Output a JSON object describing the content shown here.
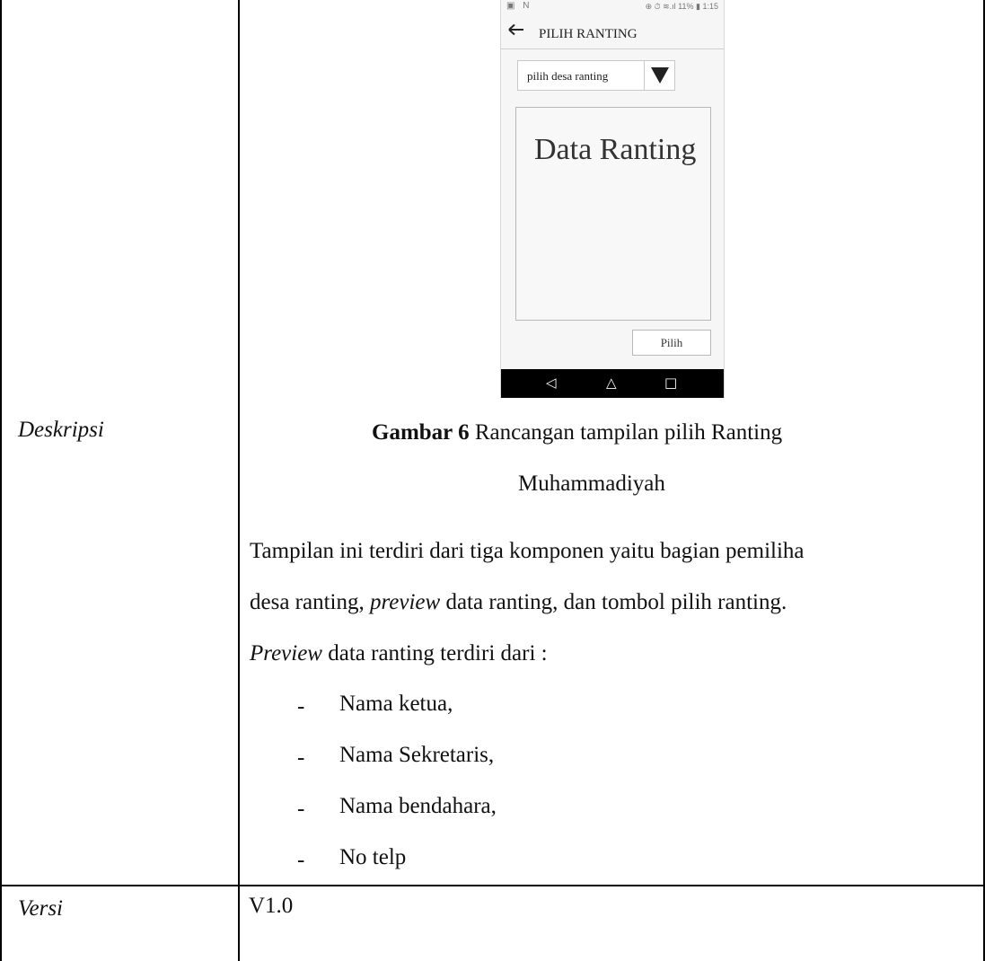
{
  "table": {
    "rows": [
      {
        "label": "Deskripsi"
      },
      {
        "label": "Versi",
        "value": "V1.0"
      }
    ]
  },
  "mockup": {
    "status_bar": {
      "left_icons": "▣ N",
      "right_text": "⊕ ⏱ ≋.ıl 11% ▮ 1:15"
    },
    "app_bar": {
      "back_icon": "arrow-left",
      "title": "PILIH RANTING"
    },
    "dropdown": {
      "value": "pilih desa ranting",
      "arrow_icon": "triangle-down"
    },
    "preview": {
      "title": "Data Ranting"
    },
    "button_label": "Pilih",
    "nav": {
      "back": "◁",
      "home": "△",
      "recents": "□"
    }
  },
  "caption": {
    "prefix": "Gambar 6",
    "line1": " Rancangan tampilan pilih Ranting",
    "line2": "Muhammadiyah"
  },
  "description": {
    "line1": "Tampilan ini terdiri dari tiga komponen yaitu bagian pemiliha",
    "line2_a": "desa ranting, ",
    "line2_em": "preview",
    "line2_b": " data ranting, dan tombol pilih ranting.",
    "line3_em": "Preview",
    "line3_b": " data ranting terdiri dari :",
    "list_marker": "-",
    "items": [
      "Nama ketua,",
      "Nama Sekretaris,",
      "Nama bendahara,",
      "No telp"
    ]
  }
}
